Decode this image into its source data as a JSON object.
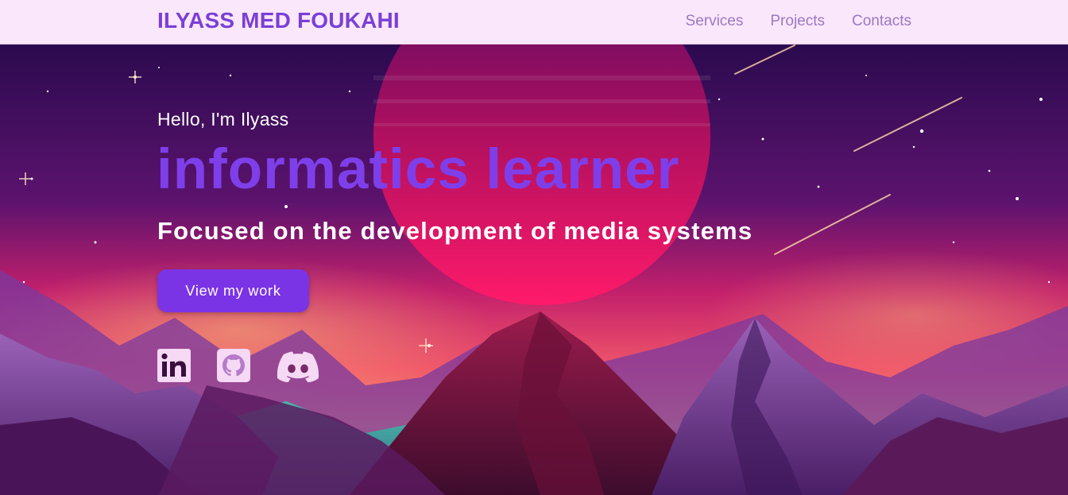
{
  "header": {
    "brand": "ILYASS MED FOUKAHI",
    "nav": [
      {
        "label": "Services"
      },
      {
        "label": "Projects"
      },
      {
        "label": "Contacts"
      }
    ]
  },
  "hero": {
    "greeting": "Hello, I'm Ilyass",
    "headline": "informatics learner",
    "subtitle": "Focused on the development of media systems",
    "cta_label": "View my work",
    "socials": [
      {
        "icon": "linkedin-icon"
      },
      {
        "icon": "github-icon"
      },
      {
        "icon": "discord-icon"
      }
    ]
  },
  "colors": {
    "nav_bg": "#fbe7fb",
    "brand": "#7b3fd6",
    "nav_link": "#9a78c4",
    "headline": "#7e3fea",
    "button": "#7b33e6",
    "icon": "#f5d9f5"
  }
}
